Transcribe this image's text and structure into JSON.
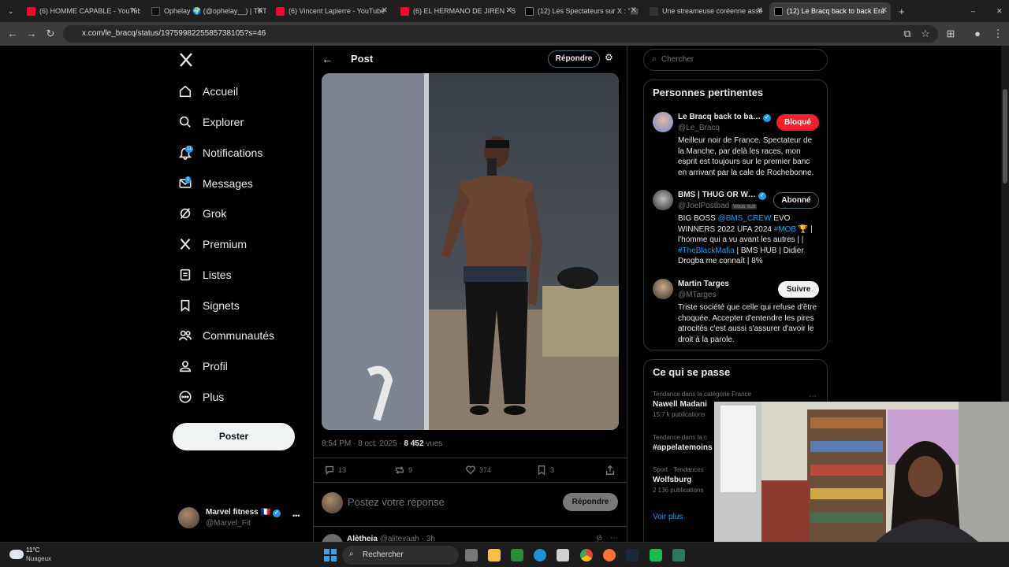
{
  "browser": {
    "tabs": [
      {
        "title": "(6) HOMME CAPABLE - YouTube",
        "color": "#ff0033"
      },
      {
        "title": "Ophelay 🌍 (@ophelay__) | TikTok",
        "color": "#111111"
      },
      {
        "title": "(6) Vincent Lapierre - YouTube",
        "color": "#ff0033"
      },
      {
        "title": "(6) EL HERMANO DE JIREN - Se",
        "color": "#ff0033"
      },
      {
        "title": "(12) Les Spectateurs sur X : \"🎥",
        "color": "#000000"
      },
      {
        "title": "Une streameuse coréenne asse",
        "color": "#333333"
      },
      {
        "title": "(12) Le Bracq back to back Era",
        "color": "#000000"
      }
    ],
    "url": "x.com/le_bracq/status/1975998225585738105?s=46"
  },
  "sidebar": {
    "items": [
      {
        "label": "Accueil",
        "icon": "home-icon"
      },
      {
        "label": "Explorer",
        "icon": "search-icon"
      },
      {
        "label": "Notifications",
        "icon": "bell-icon",
        "badge": "11"
      },
      {
        "label": "Messages",
        "icon": "mail-icon",
        "badge": "1"
      },
      {
        "label": "Grok",
        "icon": "grok-icon"
      },
      {
        "label": "Premium",
        "icon": "x-icon"
      },
      {
        "label": "Listes",
        "icon": "list-icon"
      },
      {
        "label": "Signets",
        "icon": "bookmark-icon"
      },
      {
        "label": "Communautés",
        "icon": "people-icon"
      },
      {
        "label": "Profil",
        "icon": "person-icon"
      },
      {
        "label": "Plus",
        "icon": "more-icon"
      }
    ],
    "post_button": "Poster",
    "account": {
      "name": "Marvel fitness 🇫🇷",
      "handle": "@Marvel_Fit",
      "more": "•••"
    }
  },
  "post": {
    "header_title": "Post",
    "reply_button": "Répondre",
    "time": "8:54 PM · 8 oct. 2025 · ",
    "views": "8 452",
    "views_label": "vues",
    "actions": {
      "replies": "13",
      "reposts": "9",
      "likes": "374",
      "bookmarks": "3"
    },
    "reply_placeholder": "Postez votre réponse",
    "reply_submit": "Répondre",
    "next_reply": {
      "name": "Alètheia",
      "handle": "@alitevaah · 3h"
    }
  },
  "right": {
    "search_placeholder": "Chercher",
    "people_title": "Personnes pertinentes",
    "people": [
      {
        "name": "Le Bracq back to ba…",
        "handle": "@Le_Bracq",
        "button": "Bloqué",
        "bio": "Meilleur noir de France. Spectateur de la Manche, par delà les races, mon esprit est toujours sur le premier banc en arrivant par la cale de Rochebonne."
      },
      {
        "name": "BMS | THUG OR W…",
        "handle": "@JoelPostbad",
        "follows_you": "Vous suit",
        "button": "Abonné",
        "bio_parts": [
          "BIG BOSS ",
          "@BMS_CREW",
          " EVO WINNERS 2022 UFA 2024 ",
          "#MOB",
          " 🏆 | l'homme qui a vu avant les autres | | ",
          "#TheBlackMafia",
          " | BMS HUB | Didier Drogba me connaît | 8%"
        ]
      },
      {
        "name": "Martin Targes",
        "handle": "@MTarges",
        "button": "Suivre",
        "bio": "Triste société que celle qui refuse d'être choquée. Accepter d'entendre les pires atrocités c'est aussi s'assurer d'avoir le droit à la parole."
      }
    ],
    "trends_title": "Ce qui se passe",
    "trends": [
      {
        "meta": "Tendance dans la catégorie France",
        "title": "Nawell Madani",
        "count": "15,7 k publications"
      },
      {
        "meta": "Tendance dans la c",
        "title": "#appelatemoins",
        "count": ""
      },
      {
        "meta": "Sport · Tendances",
        "title": "Wolfsburg",
        "count": "2 136 publications"
      }
    ],
    "see_more": "Voir plus"
  },
  "taskbar": {
    "weather_temp": "11°C",
    "weather_desc": "Nuageux",
    "search": "Rechercher"
  }
}
